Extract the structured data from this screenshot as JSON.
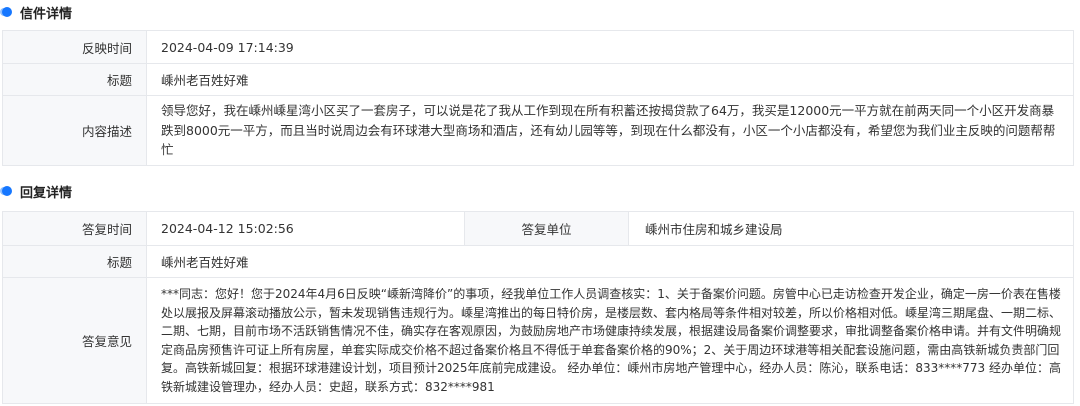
{
  "letter": {
    "section_title": "信件详情",
    "time_label": "反映时间",
    "time_value": "2024-04-09 17:14:39",
    "title_label": "标题",
    "title_value": "嵊州老百姓好难",
    "content_label": "内容描述",
    "content_value": "领导您好，我在嵊州嵊星湾小区买了一套房子，可以说是花了我从工作到现在所有积蓄还按揭贷款了64万，我买是12000元一平方就在前两天同一个小区开发商暴跌到8000元一平方，而且当时说周边会有环球港大型商场和酒店，还有幼儿园等等，到现在什么都没有，小区一个小店都没有，希望您为我们业主反映的问题帮帮忙"
  },
  "reply": {
    "section_title": "回复详情",
    "time_label": "答复时间",
    "time_value": "2024-04-12 15:02:56",
    "unit_label": "答复单位",
    "unit_value": "嵊州市住房和城乡建设局",
    "title_label": "标题",
    "title_value": "嵊州老百姓好难",
    "opinion_label": "答复意见",
    "opinion_value": "***同志：您好！您于2024年4月6日反映“嵊新湾降价”的事项，经我单位工作人员调查核实：1、关于备案价问题。房管中心已走访检查开发企业，确定一房一价表在售楼处以展报及屏幕滚动播放公示，暂未发现销售违规行为。嵊星湾推出的每日特价房，是楼层数、套内格局等条件相对较差，所以价格相对低。嵊星湾三期尾盘、一期二标、二期、七期，目前市场不活跃销售情况不佳，确实存在客观原因，为鼓励房地产市场健康持续发展，根据建设局备案价调整要求，审批调整备案价格申请。并有文件明确规定商品房预售许可证上所有房屋，单套实际成交价格不超过备案价格且不得低于单套备案价格的90%；2、关于周边环球港等相关配套设施问题，需由高铁新城负责部门回复。高铁新城回复：根据环球港建设计划，项目预计2025年底前完成建设。 经办单位：嵊州市房地产管理中心，经办人员：陈沁，联系电话：833****773 经办单位：高铁新城建设管理办，经办人员：史超，联系方式：832****981"
  },
  "colors": {
    "accent": "#1677ff",
    "label_bg": "#f7f8fa",
    "border": "#e6e8ec"
  }
}
